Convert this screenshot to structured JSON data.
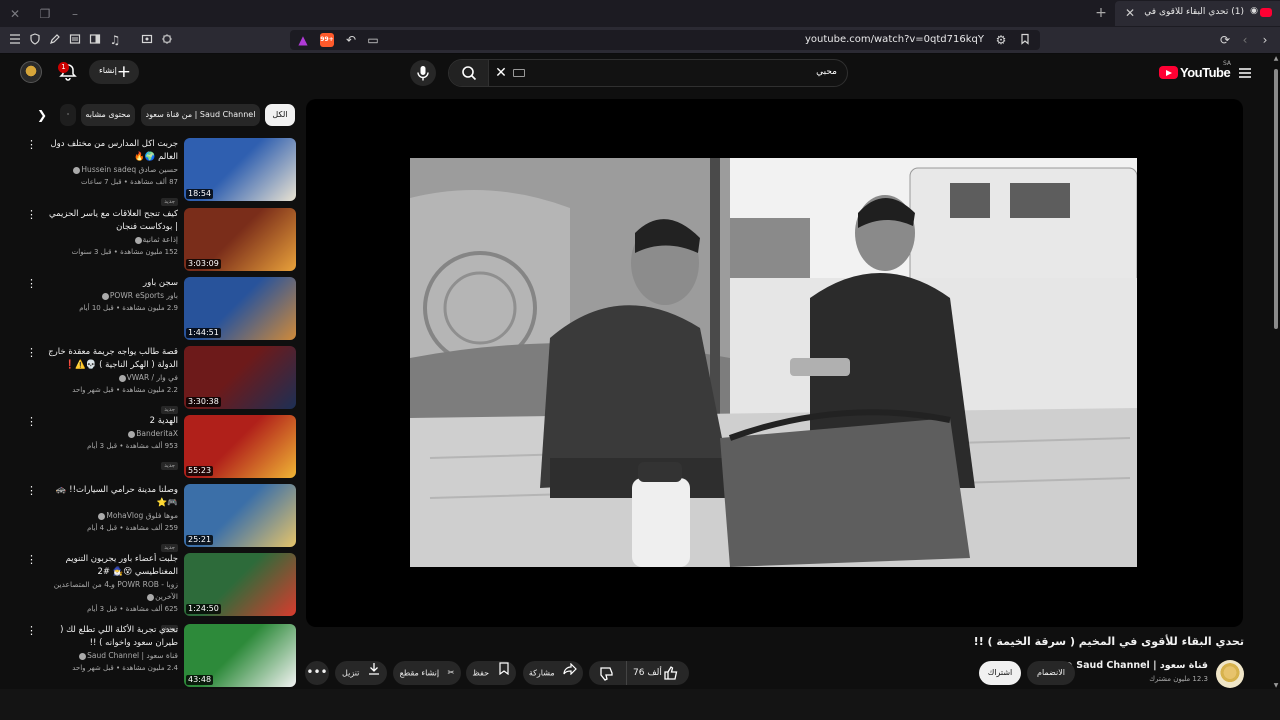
{
  "browser": {
    "tab_title": "(1) تحدي البقاء للأقوى في المخ...",
    "url": "youtube.com/watch?v=0qtd716kqY",
    "ext_badge": "99+"
  },
  "masthead": {
    "create_label": "إنشاء",
    "notification_count": "1",
    "search_value": "محبي",
    "logo_text": "YouTube",
    "country_code": "SA"
  },
  "chips": [
    "الكل",
    "من قناة سعود | Saud Channel",
    "محتوى مشابه"
  ],
  "recommendations": [
    {
      "title": "جربت اكل المدارس من مختلف دول العالم 🌍🔥",
      "channel": "حسين صادق Hussein sadeq",
      "stats": "87 ألف مشاهدة • قبل 7 ساعات",
      "new": "جديد",
      "duration": "18:54",
      "thumb_colors": [
        "#2f5fb0",
        "#eae3d2"
      ]
    },
    {
      "title": "كيف تنجح العلاقات مع ياسر الحزيمي | بودكاست فنجان",
      "channel": "إذاعة ثمانية",
      "stats": "152 مليون مشاهدة • قبل 3 سنوات",
      "new": "",
      "duration": "3:03:09",
      "thumb_colors": [
        "#7a2d1a",
        "#e9a23b"
      ]
    },
    {
      "title": "سجن باور",
      "channel": "باور POWR eSports",
      "stats": "2.9 مليون مشاهدة • قبل 10 أيام",
      "new": "",
      "duration": "1:44:51",
      "thumb_colors": [
        "#28539b",
        "#d08a3a"
      ]
    },
    {
      "title": "قصة طالب يواجه جريمة معقدة خارج الدولة ( الهكر الناجية ) 💀⚠️❗",
      "channel": "في وار / VWAR",
      "stats": "2.2 مليون مشاهدة • قبل شهر واحد",
      "new": "جديد",
      "duration": "3:30:38",
      "thumb_colors": [
        "#6d1a1a",
        "#1c2f55"
      ]
    },
    {
      "title": "الهدية 2",
      "channel": "BanderitaX",
      "stats": "953 ألف مشاهدة • قبل 3 أيام",
      "new": "جديد",
      "duration": "55:23",
      "thumb_colors": [
        "#b0201a",
        "#f0b535"
      ]
    },
    {
      "title": "وصلنا مدينة حرامي السيارات!! 🚓🎮⭐",
      "channel": "موها فلوق MohaVlog",
      "stats": "259 ألف مشاهدة • قبل 4 أيام",
      "new": "جديد",
      "duration": "25:21",
      "thumb_colors": [
        "#3b6fa8",
        "#e6c46a"
      ]
    },
    {
      "title": "جلبت أعضاء باور يجربون التنويم المغناطيسي 😵🧙‍♂️ #2",
      "channel": "زوبا - POWR ROB وـ4 من المتصاعدين الآخرين",
      "stats": "625 ألف مشاهدة • قبل 3 أيام",
      "new": "جديد",
      "duration": "1:24:50",
      "thumb_colors": [
        "#2d6b3a",
        "#d93b2e"
      ]
    },
    {
      "title": "تحدي تجربة الأكلة اللي تطلع لك ( طيران سعود واخوانه ) !!",
      "channel": "قناة سعود | Saud Channel",
      "stats": "2.4 مليون مشاهدة • قبل شهر واحد",
      "new": "",
      "duration": "43:48",
      "thumb_colors": [
        "#2d8a3a",
        "#f3f3f3"
      ]
    }
  ],
  "video": {
    "title": "تحدي البقاء للأقوى في المخيم ( سرقة الخيمة ) !!",
    "channel_name": "قناة سعود | Saud Channel",
    "subscribers": "12.3 مليون مشترك"
  },
  "actions": {
    "subscribe": "اشتراك",
    "join": "الانضمام",
    "likes": "76 ألف",
    "share": "مشاركة",
    "save": "حفظ",
    "clip": "إنشاء مقطع",
    "download": "تنزيل"
  }
}
